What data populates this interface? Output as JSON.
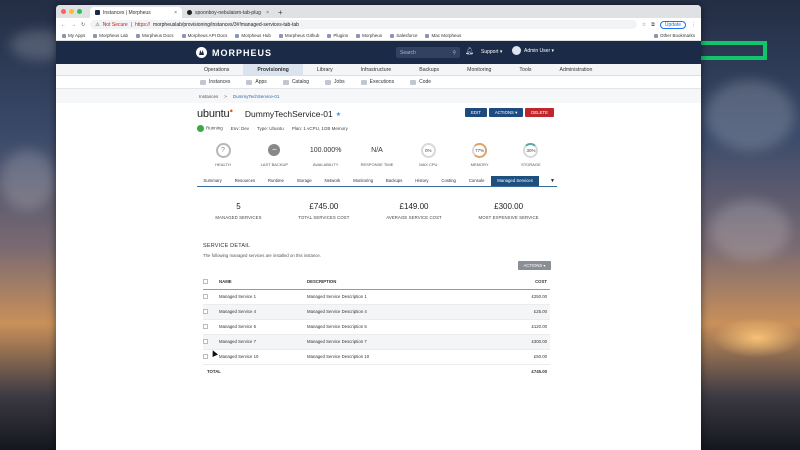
{
  "browser": {
    "tabs": [
      {
        "title": "Instances | Morpheus",
        "active": true
      },
      {
        "title": "spoonboy-nebulaism-tab-plug",
        "active": false
      }
    ],
    "new_tab_glyph": "+",
    "address": {
      "security": "Not Secure",
      "url_prefix": "https://",
      "url": "morpheuslab/provisioning/instances/3#!managed-services-tab-tab"
    },
    "update_label": "Update",
    "bookmarks": [
      "My Apps",
      "Morpheus Lab",
      "Morpheus Docs",
      "Morpheus API Docs",
      "Morpheus Hub",
      "Morpheus Github",
      "Plugins",
      "Morpheus",
      "Salesforce",
      "Mac Morpheus"
    ],
    "other_bookmarks": "Other Bookmarks"
  },
  "app": {
    "brand": "MORPHEUS",
    "search_placeholder": "Search",
    "support_label": "Support ▾",
    "user_label": "Admin User ▾"
  },
  "nav": {
    "primary": [
      "Operations",
      "Provisioning",
      "Library",
      "Infrastructure",
      "Backups",
      "Monitoring",
      "Tools",
      "Administration"
    ],
    "primary_active": "Provisioning",
    "secondary": [
      "Instances",
      "Apps",
      "Catalog",
      "Jobs",
      "Executions",
      "Code"
    ]
  },
  "breadcrumb": {
    "root": "Instances",
    "sep": ">",
    "current": "DummyTechService-01"
  },
  "instance": {
    "os_logo": "ubuntu",
    "name": "DummyTechService-01",
    "status": "Running",
    "env": "Env: Dev",
    "type": "Type: Ubuntu",
    "plan": "Plan: 1 vCPU, 1GB Memory",
    "buttons": {
      "edit": "EDIT",
      "actions": "ACTIONS ▾",
      "delete": "DELETE"
    }
  },
  "stats": [
    {
      "value": "?",
      "label": "HEALTH"
    },
    {
      "value": "−",
      "label": "LAST BACKUP"
    },
    {
      "value": "100.000%",
      "label": "AVAILABILITY"
    },
    {
      "value": "N/A",
      "label": "RESPONSE TIME"
    },
    {
      "value": "0%",
      "label": "MAX CPU"
    },
    {
      "value": "77%",
      "label": "MEMORY"
    },
    {
      "value": "30%",
      "label": "STORAGE"
    }
  ],
  "tabs": [
    "Summary",
    "Resources",
    "Runtime",
    "Storage",
    "Network",
    "Monitoring",
    "Backups",
    "History",
    "Costing",
    "Console",
    "Managed Services"
  ],
  "active_tab": "Managed Services",
  "summary": [
    {
      "value": "5",
      "label": "MANAGED SERVICES"
    },
    {
      "value": "£745.00",
      "label": "TOTAL SERVICES COST"
    },
    {
      "value": "£149.00",
      "label": "AVERAGE SERVICE COST"
    },
    {
      "value": "£300.00",
      "label": "MOST EXPENSIVE SERVICE"
    }
  ],
  "service_detail": {
    "title": "SERVICE DETAIL",
    "subtitle": "The following managed services are installed on this instance.",
    "actions_label": "ACTIONS ▾",
    "columns": [
      "NAME",
      "DESCRIPTION",
      "COST"
    ],
    "rows": [
      {
        "name": "Managed Service 1",
        "description": "Managed Service Description 1",
        "cost": "£250.00"
      },
      {
        "name": "Managed Service 4",
        "description": "Managed Service Description 4",
        "cost": "£25.00"
      },
      {
        "name": "Managed Service 5",
        "description": "Managed Service Description 5",
        "cost": "£120.00"
      },
      {
        "name": "Managed Service 7",
        "description": "Managed Service Description 7",
        "cost": "£300.00"
      },
      {
        "name": "Managed Service 10",
        "description": "Managed Service Description 10",
        "cost": "£50.00"
      }
    ],
    "total_label": "TOTAL",
    "total_value": "£745.00"
  }
}
